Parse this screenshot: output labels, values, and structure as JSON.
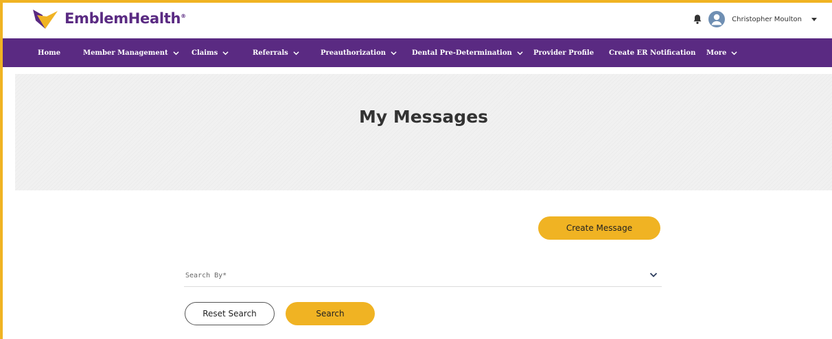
{
  "brand": {
    "name": "EmblemHealth",
    "registered_mark": "®",
    "logo_colors": {
      "purple": "#5a2a82",
      "gold": "#f0b323"
    }
  },
  "header": {
    "user_name": "Christopher Moulton",
    "bell_icon": "bell-icon",
    "avatar_icon": "user-avatar-icon"
  },
  "nav": {
    "items": [
      {
        "label": "Home",
        "has_dropdown": false
      },
      {
        "label": "Member Management",
        "has_dropdown": true
      },
      {
        "label": "Claims",
        "has_dropdown": true
      },
      {
        "label": "Referrals",
        "has_dropdown": true
      },
      {
        "label": "Preauthorization",
        "has_dropdown": true
      },
      {
        "label": "Dental Pre-Determination",
        "has_dropdown": true
      },
      {
        "label": "Provider Profile",
        "has_dropdown": false
      },
      {
        "label": "Create ER Notification",
        "has_dropdown": false
      },
      {
        "label": "More",
        "has_dropdown": true
      }
    ]
  },
  "page": {
    "title": "My Messages"
  },
  "actions": {
    "create_message": "Create Message",
    "reset_search": "Reset Search",
    "search": "Search"
  },
  "search": {
    "search_by_placeholder": "Search By*"
  },
  "colors": {
    "accent_yellow": "#f0b323",
    "nav_purple": "#5a2a82",
    "hero_gray": "#f1f1f1"
  }
}
